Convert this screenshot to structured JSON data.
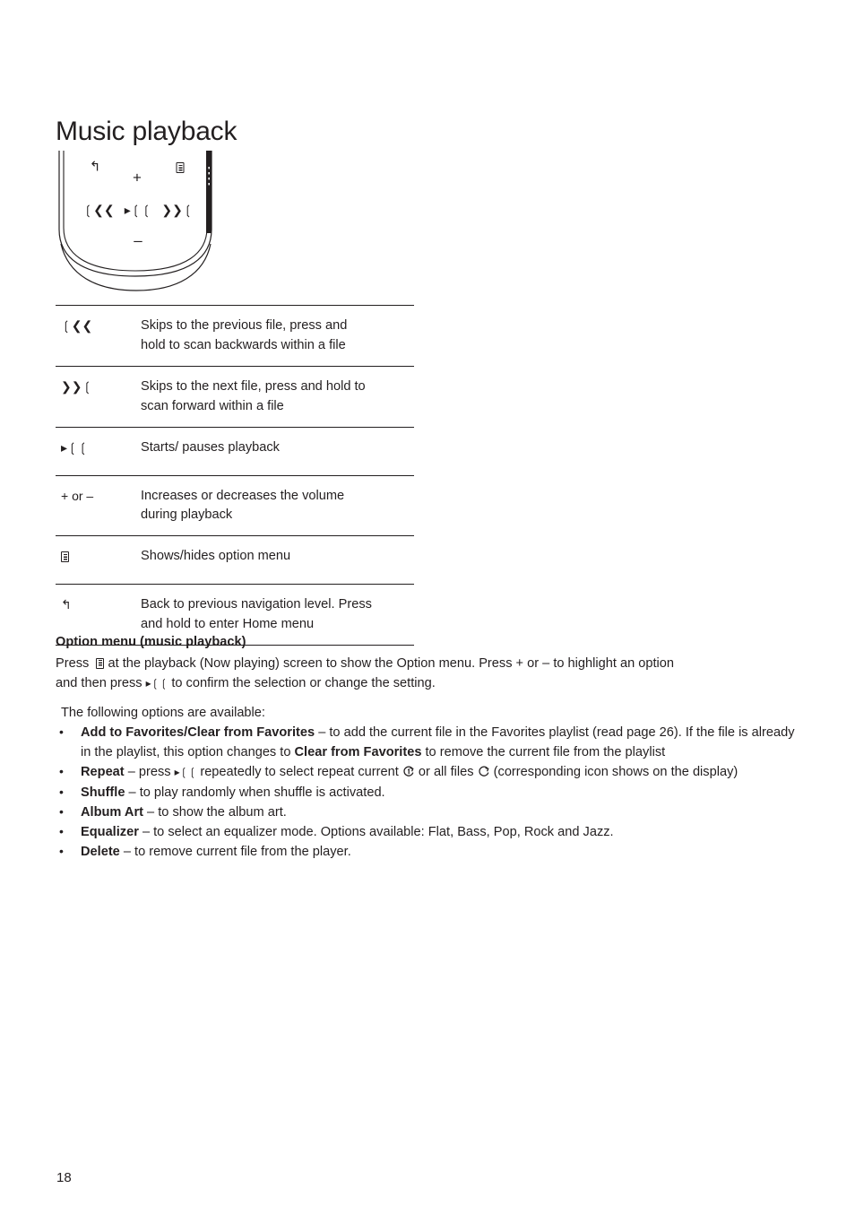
{
  "page": {
    "title": "Music playback",
    "number": "18"
  },
  "device": {
    "name": "music-player-device",
    "buttons": [
      {
        "id": "back",
        "glyph": "↶",
        "name": "back-button"
      },
      {
        "id": "menu",
        "glyph": "menu-icon",
        "name": "option-menu-button"
      },
      {
        "id": "plus",
        "glyph": "+",
        "name": "volume-up-button"
      },
      {
        "id": "prev",
        "glyph": "⏮",
        "name": "previous-button"
      },
      {
        "id": "play",
        "glyph": "▶‖",
        "name": "play-pause-button"
      },
      {
        "id": "next",
        "glyph": "⏭",
        "name": "next-button"
      },
      {
        "id": "minus",
        "glyph": "–",
        "name": "volume-down-button"
      }
    ]
  },
  "reference_table": {
    "rows": [
      {
        "icon": "❘❮❮",
        "icon_name": "previous-track-icon",
        "lines": [
          "Skips to the previous file, press and",
          "hold to scan backwards within a file"
        ]
      },
      {
        "icon": "❯❯❘",
        "icon_name": "next-track-icon",
        "lines": [
          "Skips to the next file, press and hold to",
          "scan forward within a file"
        ]
      },
      {
        "icon": "▶❘❘",
        "icon_name": "play-pause-icon",
        "lines": [
          "Starts/ pauses playback"
        ]
      },
      {
        "icon": "+ or –",
        "icon_name": "volume-plus-minus-icon",
        "lines": [
          "Increases or decreases the volume",
          "during playback"
        ]
      },
      {
        "icon": "menu-icon",
        "icon_name": "option-menu-icon",
        "lines": [
          "Shows/hides option menu"
        ]
      },
      {
        "icon": "↶",
        "icon_name": "back-arrow-icon",
        "lines": [
          "Back to previous navigation level. Press",
          "and hold to enter Home menu"
        ]
      }
    ]
  },
  "option_menu": {
    "heading": "Option menu (music playback)",
    "para_line1_a": "Press",
    "para_line1_b": "at the playback (Now playing) screen to show the Option menu. Press + or – to highlight an option",
    "para_line2_a": "and then press",
    "para_line2_b": "to confirm the selection or change the setting.",
    "available_intro": "The following options are available:",
    "bullet_char": "•",
    "items": [
      {
        "name": "add-to-favorites",
        "bold1": "Add to Favorites/Clear from Favorites",
        "text1": " – to add the current file in the Favorites playlist (read page 26). If the file is already in the playlist, this option changes to ",
        "bold2": "Clear from Favorites",
        "text2": " to remove the current file from the playlist"
      },
      {
        "name": "repeat",
        "bold1": "Repeat",
        "text1": " – press ",
        "text_mid": " repeatedly to select repeat current ",
        "text_mid2": " or all files ",
        "text2": " (corresponding icon shows on the display)"
      },
      {
        "name": "shuffle",
        "bold1": "Shuffle",
        "text1": " –  to play randomly when shuffle is activated."
      },
      {
        "name": "album-art",
        "bold1": "Album Art",
        "text1": " – to show the album art."
      },
      {
        "name": "equalizer",
        "bold1": "Equalizer",
        "text1": " –  to select an equalizer mode. Options available: Flat, Bass, Pop, Rock and Jazz."
      },
      {
        "name": "delete",
        "bold1": "Delete",
        "text1": " – to remove current file from the player."
      }
    ]
  }
}
